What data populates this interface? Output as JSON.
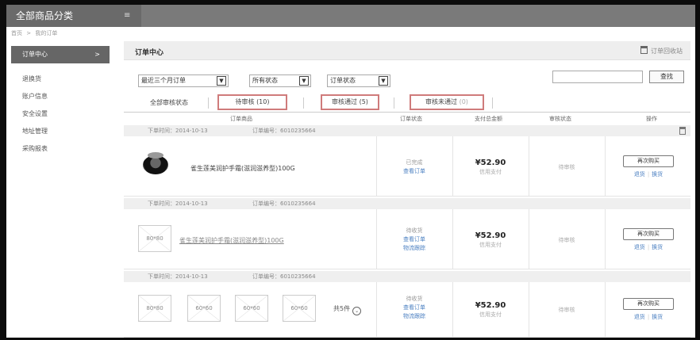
{
  "header": {
    "category_tab": "全部商品分类",
    "menu_icon": "menu-icon"
  },
  "breadcrumb": {
    "home": "首页",
    "sep": ">",
    "current": "我的订单"
  },
  "sidebar": {
    "active": "订单中心",
    "active_chevron": ">",
    "items": [
      "退换货",
      "账户信息",
      "安全设置",
      "地址管理",
      "采购报表"
    ]
  },
  "main": {
    "title": "订单中心",
    "recycle_label": "订单回收站",
    "filters": [
      "最近三个月订单",
      "所有状态",
      "订单状态"
    ],
    "filter_arrow": "▼",
    "search_button": "查找",
    "tabs": {
      "all": "全部审核状态",
      "pending": "待审核",
      "pending_count": "(10)",
      "passed": "审核通过",
      "passed_count": "(5)",
      "failed": "审核未通过",
      "failed_count": "(0)"
    },
    "columns": {
      "product": "订单商品",
      "status": "订单状态",
      "total": "支付总金额",
      "audit": "审核状态",
      "ops": "操作"
    }
  },
  "orders": [
    {
      "time_label": "下单时间：",
      "time": "2014-10-13",
      "no_label": "订单编号：",
      "no": "6010235664",
      "product_name": "雀生莲美润护手霜(滋润滋养型)100G",
      "status": "已完成",
      "status_links": [
        "查看订单"
      ],
      "price": "¥52.90",
      "pay": "信用支付",
      "audit": "待审核",
      "rebuy": "再次购买",
      "op_links": [
        "退货",
        "换货"
      ]
    },
    {
      "time_label": "下单时间：",
      "time": "2014-10-13",
      "no_label": "订单编号：",
      "no": "6010235664",
      "img_label": "80*80",
      "product_name": "雀生莲美润护手霜(滋润滋养型)100G",
      "status": "待收货",
      "status_links": [
        "查看订单",
        "物流跟踪"
      ],
      "price": "¥52.90",
      "pay": "信用支付",
      "audit": "待审核",
      "rebuy": "再次购买",
      "op_links": [
        "退货",
        "换货"
      ]
    },
    {
      "time_label": "下单时间：",
      "time": "2014-10-13",
      "no_label": "订单编号：",
      "no": "6010235664",
      "img_labels": [
        "80*80",
        "60*60",
        "60*60",
        "60*60"
      ],
      "more": "共5件",
      "more_icon": "⌄",
      "status": "待收货",
      "status_links": [
        "查看订单",
        "物流跟踪"
      ],
      "price": "¥52.90",
      "pay": "信用支付",
      "audit": "待审核",
      "rebuy": "再次购买",
      "op_links": [
        "退货",
        "换货"
      ]
    }
  ]
}
